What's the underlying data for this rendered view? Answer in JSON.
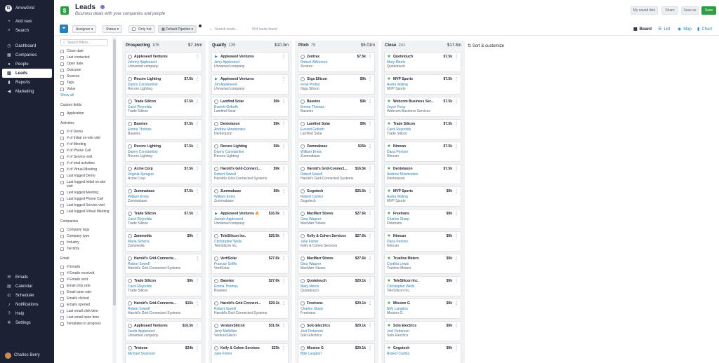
{
  "nav": {
    "brand": "ArrowGrid",
    "brand_initial": "G",
    "top_items": [
      {
        "label": "Add new",
        "icon": "plus-icon",
        "glyph": "+"
      },
      {
        "label": "Search",
        "icon": "search-icon",
        "glyph": "⌕"
      }
    ],
    "main_items": [
      {
        "label": "Dashboard",
        "icon": "dashboard-icon",
        "glyph": "◷"
      },
      {
        "label": "Companies",
        "icon": "building-icon",
        "glyph": "▦"
      },
      {
        "label": "People",
        "icon": "person-icon",
        "glyph": "●"
      },
      {
        "label": "Leads",
        "icon": "leads-icon",
        "glyph": "▥",
        "active": true
      },
      {
        "label": "Reports",
        "icon": "chart-icon",
        "glyph": "▮"
      },
      {
        "label": "Marketing",
        "icon": "megaphone-icon",
        "glyph": "◀"
      }
    ],
    "bottom_items": [
      {
        "label": "Emails",
        "icon": "mail-icon",
        "glyph": "✉"
      },
      {
        "label": "Calendar",
        "icon": "calendar-icon",
        "glyph": "▤"
      },
      {
        "label": "Scheduler",
        "icon": "clock-icon",
        "glyph": "◴"
      },
      {
        "label": "Notifications",
        "icon": "bell-icon",
        "glyph": "♪"
      },
      {
        "label": "Help",
        "icon": "help-icon",
        "glyph": "?"
      },
      {
        "label": "Settings",
        "icon": "gear-icon",
        "glyph": "✲"
      }
    ],
    "user_name": "Charles Berry"
  },
  "header": {
    "logo_glyph": "$",
    "title": "Leads",
    "subtitle": "Business deals with your companies and people",
    "buttons": {
      "saved_lists": "My saved lists",
      "share": "Share",
      "save_as": "Save as",
      "save": "Save"
    }
  },
  "toolbar": {
    "filter_glyph": "⏷",
    "assignee": "Assignee",
    "status": "Status",
    "only_hot": "Only hot",
    "pipeline": "Default Pipeline",
    "search_placeholder": "Search leads...",
    "count": "564 leads found",
    "views": {
      "board": "Board",
      "list": "List",
      "map": "Map",
      "chart": "Chart"
    }
  },
  "filters": {
    "search_placeholder": "Search filters...",
    "general": [
      "Close date",
      "Last contacted",
      "Open date",
      "Outcome",
      "Sources",
      "Tags",
      "Value"
    ],
    "show_all": "Show all",
    "custom_heading": "Custom fields",
    "custom": [
      "Application"
    ],
    "activities_heading": "Activities",
    "activities": [
      "# of Demo",
      "# of Initial on-site visit",
      "# of Meeting",
      "# of Phone Call",
      "# of Service visit",
      "# of total activities",
      "# of Virtual Meeting",
      "Last logged Demo",
      "Last logged Initial on-site visit",
      "Last logged Meeting",
      "Last logged Phone Call",
      "Last logged Service visit",
      "Last logged Virtual Meeting"
    ],
    "companies_heading": "Companies",
    "companies": [
      "Company tags",
      "Company type",
      "Industry",
      "Territory"
    ],
    "email_heading": "Email",
    "email": [
      "# Emails",
      "# Emails received",
      "# Emails sent",
      "Email click rate",
      "Email open rate",
      "Emails clicked",
      "Emails opened",
      "Last email click time",
      "Last email open time",
      "Templates in progress"
    ]
  },
  "board": {
    "sort_label": "Sort & customize",
    "columns": [
      {
        "name": "Prospecting",
        "count": "105",
        "total": "$7.16m",
        "cards": [
          {
            "company": "Appleseed Ventures",
            "value": "",
            "contact": "Johnny Appleseed",
            "sub": "Unnamed company",
            "italic": true,
            "status": "open"
          },
          {
            "company": "Recore Lighting",
            "value": "$7.5k",
            "contact": "Danny Constantino",
            "sub": "Recore Lighting",
            "status": "open"
          },
          {
            "company": "Trade Silicon",
            "value": "$7.5k",
            "contact": "Carol Reynolds",
            "sub": "Trade Silicon",
            "status": "open"
          },
          {
            "company": "Basetex",
            "value": "$7.5k",
            "contact": "Emma Thomas",
            "sub": "Basetex",
            "status": "open"
          },
          {
            "company": "Recore Lighting",
            "value": "$7.5k",
            "contact": "Danny Constantino",
            "sub": "Recore Lighting",
            "status": "open"
          },
          {
            "company": "Acme Corp",
            "value": "$7.5k",
            "contact": "Virginia Sprague",
            "sub": "Acme Corp",
            "status": "open"
          },
          {
            "company": "Zummabase",
            "value": "$7.5k",
            "contact": "William Ennis",
            "sub": "Zummabase",
            "status": "open"
          },
          {
            "company": "Trade Silicon",
            "value": "$7.5k",
            "contact": "Carol Reynolds",
            "sub": "Trade Silicon",
            "status": "open"
          },
          {
            "company": "Zammedia",
            "value": "$9k",
            "contact": "Maria Simons",
            "sub": "Zammedia",
            "status": "open"
          },
          {
            "company": "Harold's Grid-Connecte...",
            "value": "",
            "contact": "Robert Sowell",
            "sub": "Harold's Grid-Connected Systems",
            "status": "open"
          },
          {
            "company": "Trade Silicon",
            "value": "$9k",
            "contact": "Carol Reynolds",
            "sub": "Trade Silicon",
            "status": "open"
          },
          {
            "company": "Harold's Grid-Connecte...",
            "value": "$15k",
            "contact": "Robert Sowell",
            "sub": "Harold's Grid-Connected Systems",
            "status": "open"
          },
          {
            "company": "Appleseed Ventures",
            "value": "$16.5k",
            "contact": "Jacob Appleseed",
            "sub": "Unnamed company",
            "italic": true,
            "status": "open"
          },
          {
            "company": "Tristone",
            "value": "$24k",
            "contact": "Michael Swanson",
            "sub": "",
            "status": "open"
          }
        ]
      },
      {
        "name": "Qualify",
        "count": "139",
        "total": "$10.3m",
        "cards": [
          {
            "company": "Appleseed Ventures",
            "value": "",
            "contact": "Jerry Appleseed",
            "sub": "Unnamed company",
            "italic": true,
            "status": "play"
          },
          {
            "company": "Appleseed Ventures",
            "value": "",
            "contact": "Jim Appleseed",
            "sub": "Unnamed company",
            "italic": true,
            "status": "play"
          },
          {
            "company": "Lamfind Solar",
            "value": "$9k",
            "contact": "Everett Goforth",
            "sub": "Lamfind Solar",
            "status": "open"
          },
          {
            "company": "Dentotaxon",
            "value": "$9k",
            "contact": "Andrew Miramontes",
            "sub": "Dentotaxon",
            "status": "open"
          },
          {
            "company": "Recore Lighting",
            "value": "$9k",
            "contact": "Danny Constantino",
            "sub": "Recore Lighting",
            "status": "open"
          },
          {
            "company": "Harold's Grid-Connect...",
            "value": "$9k",
            "contact": "Robert Sowell",
            "sub": "Harold's Grid-Connected Systems",
            "status": "open"
          },
          {
            "company": "Zummabase",
            "value": "$9k",
            "contact": "William Ennis",
            "sub": "Zummabase",
            "status": "open"
          },
          {
            "company": "Appleseed Ventures 🔥",
            "value": "$16.5k",
            "contact": "Joseph Appleseed",
            "sub": "Unnamed company",
            "italic": true,
            "status": "play"
          },
          {
            "company": "TeleSilicon Inc.",
            "value": "$25.5k",
            "contact": "Christopher Wells",
            "sub": "TeleSilicon Inc.",
            "status": "open"
          },
          {
            "company": "VertiSolar",
            "value": "$27.6k",
            "contact": "Frances Griffis",
            "sub": "VertiSolar",
            "status": "open"
          },
          {
            "company": "Basetex",
            "value": "$27.6k",
            "contact": "Emma Thomas",
            "sub": "Basetex",
            "status": "open"
          },
          {
            "company": "Harold's Grid-Connect...",
            "value": "$29.1k",
            "contact": "Robert Sowell",
            "sub": "Harold's Grid-Connected Systems",
            "status": "open"
          },
          {
            "company": "VentureSilicon",
            "value": "$31.5k",
            "contact": "Jerry McMillan",
            "sub": "VentureSilicon",
            "status": "open"
          },
          {
            "company": "Kelly & Cohen Services",
            "value": "$33k",
            "contact": "Julie Fisher",
            "sub": "",
            "status": "open"
          }
        ]
      },
      {
        "name": "Pitch",
        "count": "79",
        "total": "$5.01m",
        "cards": [
          {
            "company": "Zentrax",
            "value": "$7.5k",
            "contact": "Robert Wilkerson",
            "sub": "Zentrax",
            "status": "open"
          },
          {
            "company": "Giga Silicon",
            "value": "$9k",
            "contact": "Irene Probst",
            "sub": "Giga Silicon",
            "status": "open"
          },
          {
            "company": "Basetex",
            "value": "$9k",
            "contact": "Emma Thomas",
            "sub": "Basetex",
            "status": "open"
          },
          {
            "company": "Lamfind Solar",
            "value": "$9k",
            "contact": "Everett Goforth",
            "sub": "Lamfind Solar",
            "status": "open"
          },
          {
            "company": "Zummabase",
            "value": "$15k",
            "contact": "William Ennis",
            "sub": "Zummabase",
            "status": "open"
          },
          {
            "company": "Harold's Grid-Connect...",
            "value": "$16.5k",
            "contact": "Robert Sowell",
            "sub": "Harold's Grid-Connected Systems",
            "status": "open"
          },
          {
            "company": "Gogotech",
            "value": "$25.5k",
            "contact": "Robert Carlino",
            "sub": "Gogotech",
            "status": "open"
          },
          {
            "company": "MacMarr Stores",
            "value": "$27.6k",
            "contact": "Gina Wagner",
            "sub": "MacMarr Stores",
            "status": "open"
          },
          {
            "company": "Kelly & Cohen Services",
            "value": "$27.6k",
            "contact": "Julie Fisher",
            "sub": "Kelly & Cohen Services",
            "status": "open"
          },
          {
            "company": "MacMarr Stores",
            "value": "$27.6k",
            "contact": "Gina Wagner",
            "sub": "MacMarr Stores",
            "status": "open"
          },
          {
            "company": "Quotetouch",
            "value": "$29.1k",
            "contact": "Mary Morris",
            "sub": "Quotetouch",
            "status": "open"
          },
          {
            "company": "Freetrans",
            "value": "$29.1k",
            "contact": "Charles Sharp",
            "sub": "Freetrans",
            "status": "open"
          },
          {
            "company": "Solo Electrics",
            "value": "$29.1k",
            "contact": "Joel Pederson",
            "sub": "Solo Electrics",
            "status": "open"
          },
          {
            "company": "Mission G",
            "value": "$29.1k",
            "contact": "Billy Langdon",
            "sub": "",
            "status": "open"
          }
        ]
      },
      {
        "name": "Close",
        "count": "241",
        "total": "$17.8m",
        "cards": [
          {
            "company": "Quotetouch",
            "value": "$7.5k",
            "contact": "Mary Morris",
            "sub": "Quotetouch",
            "status": "won"
          },
          {
            "company": "MVP Sports",
            "value": "$7.5k",
            "contact": "Audra Waling",
            "sub": "MVP Sports",
            "status": "won"
          },
          {
            "company": "Webcom Business Ser...",
            "value": "$7.5k",
            "contact": "Joyce Pong",
            "sub": "Webcom Business Services",
            "status": "won"
          },
          {
            "company": "Trade Silicon",
            "value": "$7.5k",
            "contact": "Carol Reynolds",
            "sub": "Trade Silicon",
            "status": "won"
          },
          {
            "company": "Nimcan",
            "value": "$7.5k",
            "contact": "Dana Perkins",
            "sub": "Nimcan",
            "status": "won"
          },
          {
            "company": "Dentotaxon",
            "value": "$7.5k",
            "contact": "Andrew Miramontes",
            "sub": "Dentotaxon",
            "status": "won"
          },
          {
            "company": "MVP Sports",
            "value": "$9k",
            "contact": "Audra Waling",
            "sub": "MVP Sports",
            "status": "won"
          },
          {
            "company": "Freetrans",
            "value": "$9k",
            "contact": "Charles Sharp",
            "sub": "Freetrans",
            "status": "won"
          },
          {
            "company": "Nimcan",
            "value": "$9k",
            "contact": "Dana Perkins",
            "sub": "Nimcan",
            "status": "won"
          },
          {
            "company": "Trueline Meters",
            "value": "$9k",
            "contact": "Cynthia Lewis",
            "sub": "Trueline Meters",
            "status": "won"
          },
          {
            "company": "TeleSilicon Inc.",
            "value": "$9k",
            "contact": "Christopher Wells",
            "sub": "TeleSilicon Inc.",
            "status": "won"
          },
          {
            "company": "Mission G",
            "value": "$9k",
            "contact": "Billy Langdon",
            "sub": "Mission G",
            "status": "won"
          },
          {
            "company": "Solo Electrics",
            "value": "$9k",
            "contact": "Joel Pederson",
            "sub": "Solo Electrics",
            "status": "won"
          },
          {
            "company": "Gogotech",
            "value": "$9k",
            "contact": "Robert Carlino",
            "sub": "",
            "status": "won"
          }
        ]
      }
    ]
  }
}
